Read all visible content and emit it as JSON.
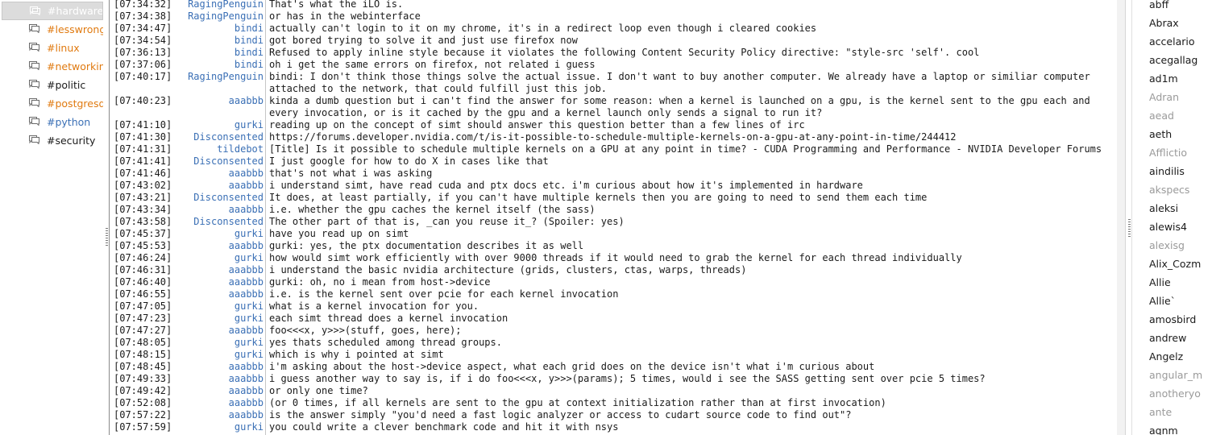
{
  "channels": [
    {
      "name": "#hardware",
      "color": "#ffffff",
      "active": true
    },
    {
      "name": "#lesswrong",
      "color": "#e07a10"
    },
    {
      "name": "#linux",
      "color": "#e07a10"
    },
    {
      "name": "#networking",
      "color": "#e07a10"
    },
    {
      "name": "#politic",
      "color": "#1a1a1a"
    },
    {
      "name": "#postgresql",
      "color": "#e07a10"
    },
    {
      "name": "#python",
      "color": "#3a6fb5"
    },
    {
      "name": "#security",
      "color": "#1a1a1a"
    }
  ],
  "messages": [
    {
      "ts": "[07:34:32]",
      "nick": "RagingPenguin",
      "text": "That's what the iLO is."
    },
    {
      "ts": "[07:34:38]",
      "nick": "RagingPenguin",
      "text": "or has in the webinterface"
    },
    {
      "ts": "[07:34:47]",
      "nick": "bindi",
      "text": "actually can't login to it on my chrome, it's in a redirect loop even though i cleared cookies"
    },
    {
      "ts": "[07:34:54]",
      "nick": "bindi",
      "text": "got bored trying to solve it and just use firefox now"
    },
    {
      "ts": "[07:36:13]",
      "nick": "bindi",
      "text": "Refused to apply inline style because it violates the following Content Security Policy directive: \"style-src 'self'. cool"
    },
    {
      "ts": "[07:37:06]",
      "nick": "bindi",
      "text": "oh i get the same errors on firefox, not related i guess"
    },
    {
      "ts": "[07:40:17]",
      "nick": "RagingPenguin",
      "text": "bindi: I don't think those things solve the actual issue. I don't want to buy another computer. We already have a laptop or similiar computer attached to the network, that could fulfill just this job."
    },
    {
      "ts": "[07:40:23]",
      "nick": "aaabbb",
      "text": "kinda a dumb question but i can't find the answer for some reason: when a kernel is launched on a gpu, is the kernel sent to the gpu each and every invocation, or is it cached by the gpu and a kernel launch only sends a signal to run it?"
    },
    {
      "ts": "[07:41:10]",
      "nick": "gurki",
      "text": "reading up on the concept of simt should answer this question better than a few lines of irc"
    },
    {
      "ts": "[07:41:30]",
      "nick": "Disconsented",
      "text": "https://forums.developer.nvidia.com/t/is-it-possible-to-schedule-multiple-kernels-on-a-gpu-at-any-point-in-time/244412"
    },
    {
      "ts": "[07:41:31]",
      "nick": "tildebot",
      "text": "[Title] Is it possible to schedule multiple kernels on a GPU at any point in time? - CUDA Programming and Performance - NVIDIA Developer Forums"
    },
    {
      "ts": "[07:41:41]",
      "nick": "Disconsented",
      "text": "I just google for how to do X in cases like that"
    },
    {
      "ts": "[07:41:46]",
      "nick": "aaabbb",
      "text": "that's not what i was asking"
    },
    {
      "ts": "[07:43:02]",
      "nick": "aaabbb",
      "text": "i understand simt, have read cuda and ptx docs etc. i'm curious about how it's implemented in hardware"
    },
    {
      "ts": "[07:43:21]",
      "nick": "Disconsented",
      "text": "It does, at least partially, if you can't have multiple kernels then you are going to need to send them each time"
    },
    {
      "ts": "[07:43:34]",
      "nick": "aaabbb",
      "text": "i.e. whether the gpu caches the kernel itself (the sass)"
    },
    {
      "ts": "[07:43:58]",
      "nick": "Disconsented",
      "text": "The other part of that is, _can you reuse it_? (Spoiler: yes)"
    },
    {
      "ts": "[07:45:37]",
      "nick": "gurki",
      "text": "have you read up on simt"
    },
    {
      "ts": "[07:45:53]",
      "nick": "aaabbb",
      "text": "gurki: yes, the ptx documentation describes it as well"
    },
    {
      "ts": "[07:46:24]",
      "nick": "gurki",
      "text": "how would simt work efficiently with over 9000 threads if it would need to grab the kernel for each thread individually"
    },
    {
      "ts": "[07:46:31]",
      "nick": "aaabbb",
      "text": "i understand the basic nvidia architecture (grids, clusters, ctas, warps, threads)"
    },
    {
      "ts": "[07:46:40]",
      "nick": "aaabbb",
      "text": "gurki: oh, no i mean from host->device"
    },
    {
      "ts": "[07:46:55]",
      "nick": "aaabbb",
      "text": "i.e. is the kernel sent over pcie for each kernel invocation"
    },
    {
      "ts": "[07:47:05]",
      "nick": "gurki",
      "text": "what is a kernel invocation for you."
    },
    {
      "ts": "[07:47:23]",
      "nick": "gurki",
      "text": "each simt thread does a kernel invocation"
    },
    {
      "ts": "[07:47:27]",
      "nick": "aaabbb",
      "text": "foo<<<x, y>>>(stuff, goes, here);"
    },
    {
      "ts": "[07:48:05]",
      "nick": "gurki",
      "text": "yes thats scheduled among thread groups."
    },
    {
      "ts": "[07:48:15]",
      "nick": "gurki",
      "text": "which is why i pointed at simt"
    },
    {
      "ts": "[07:48:45]",
      "nick": "aaabbb",
      "text": "i'm asking about the host->device aspect, what each grid does on the device isn't what i'm curious about"
    },
    {
      "ts": "[07:49:33]",
      "nick": "aaabbb",
      "text": "i guess another way to say is, if i do foo<<<x, y>>>(params); 5 times, would i see the SASS getting sent over pcie 5 times?"
    },
    {
      "ts": "[07:49:42]",
      "nick": "aaabbb",
      "text": "or only one time?"
    },
    {
      "ts": "[07:52:08]",
      "nick": "aaabbb",
      "text": "(or 0 times, if all kernels are sent to the gpu at context initialization rather than at first invocation)"
    },
    {
      "ts": "[07:57:22]",
      "nick": "aaabbb",
      "text": "is the answer simply \"you'd need a fast logic analyzer or access to cudart source code to find out\"?"
    },
    {
      "ts": "[07:57:59]",
      "nick": "gurki",
      "text": "you could write a clever benchmark code and hit it with nsys"
    }
  ],
  "users": [
    {
      "name": "abff",
      "away": false
    },
    {
      "name": "Abrax",
      "away": false
    },
    {
      "name": "accelario",
      "away": false
    },
    {
      "name": "acegallag",
      "away": false
    },
    {
      "name": "ad1m",
      "away": false
    },
    {
      "name": "Adran",
      "away": true
    },
    {
      "name": "aead",
      "away": true
    },
    {
      "name": "aeth",
      "away": false
    },
    {
      "name": "Afflictio",
      "away": true
    },
    {
      "name": "aindilis",
      "away": false
    },
    {
      "name": "akspecs",
      "away": true
    },
    {
      "name": "aleksi",
      "away": false
    },
    {
      "name": "alewis4",
      "away": false
    },
    {
      "name": "alexisg",
      "away": true
    },
    {
      "name": "Alix_Cozm",
      "away": false
    },
    {
      "name": "Allie",
      "away": false
    },
    {
      "name": "Allie`",
      "away": false
    },
    {
      "name": "amosbird",
      "away": false
    },
    {
      "name": "andrew",
      "away": false
    },
    {
      "name": "Angelz",
      "away": false
    },
    {
      "name": "angular_m",
      "away": true
    },
    {
      "name": "anotheryo",
      "away": true
    },
    {
      "name": "ante",
      "away": true
    },
    {
      "name": "aqnm",
      "away": false
    }
  ],
  "colors": {
    "nick": "#3a6fb5",
    "channel_highlight": "#e07a10",
    "channel_python": "#3a6fb5",
    "away_user": "#9a9a9a"
  }
}
